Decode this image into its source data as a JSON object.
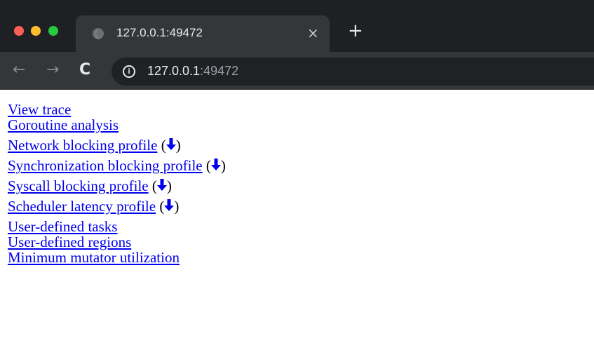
{
  "browser": {
    "tab_title": "127.0.0.1:49472",
    "tab_close": "×",
    "new_tab": "+",
    "back": "←",
    "forward": "→",
    "reload": "C",
    "info_icon_glyph": "i",
    "url_host": "127.0.0.1",
    "url_port": ":49472",
    "colors": {
      "tabstrip": "#1f2023",
      "active_tab": "#35363a",
      "link": "#0000ee"
    }
  },
  "links": [
    {
      "label": "View trace"
    },
    {
      "label": "Goroutine analysis"
    },
    {
      "label": "Network blocking profile",
      "download": true
    },
    {
      "label": "Synchronization blocking profile",
      "download": true
    },
    {
      "label": "Syscall blocking profile",
      "download": true
    },
    {
      "label": "Scheduler latency profile",
      "download": true
    },
    {
      "label": "User-defined tasks"
    },
    {
      "label": "User-defined regions"
    },
    {
      "label": "Minimum mutator utilization"
    }
  ],
  "download_icon": "download-arrow-icon",
  "paren_open": "(",
  "paren_close": ")"
}
